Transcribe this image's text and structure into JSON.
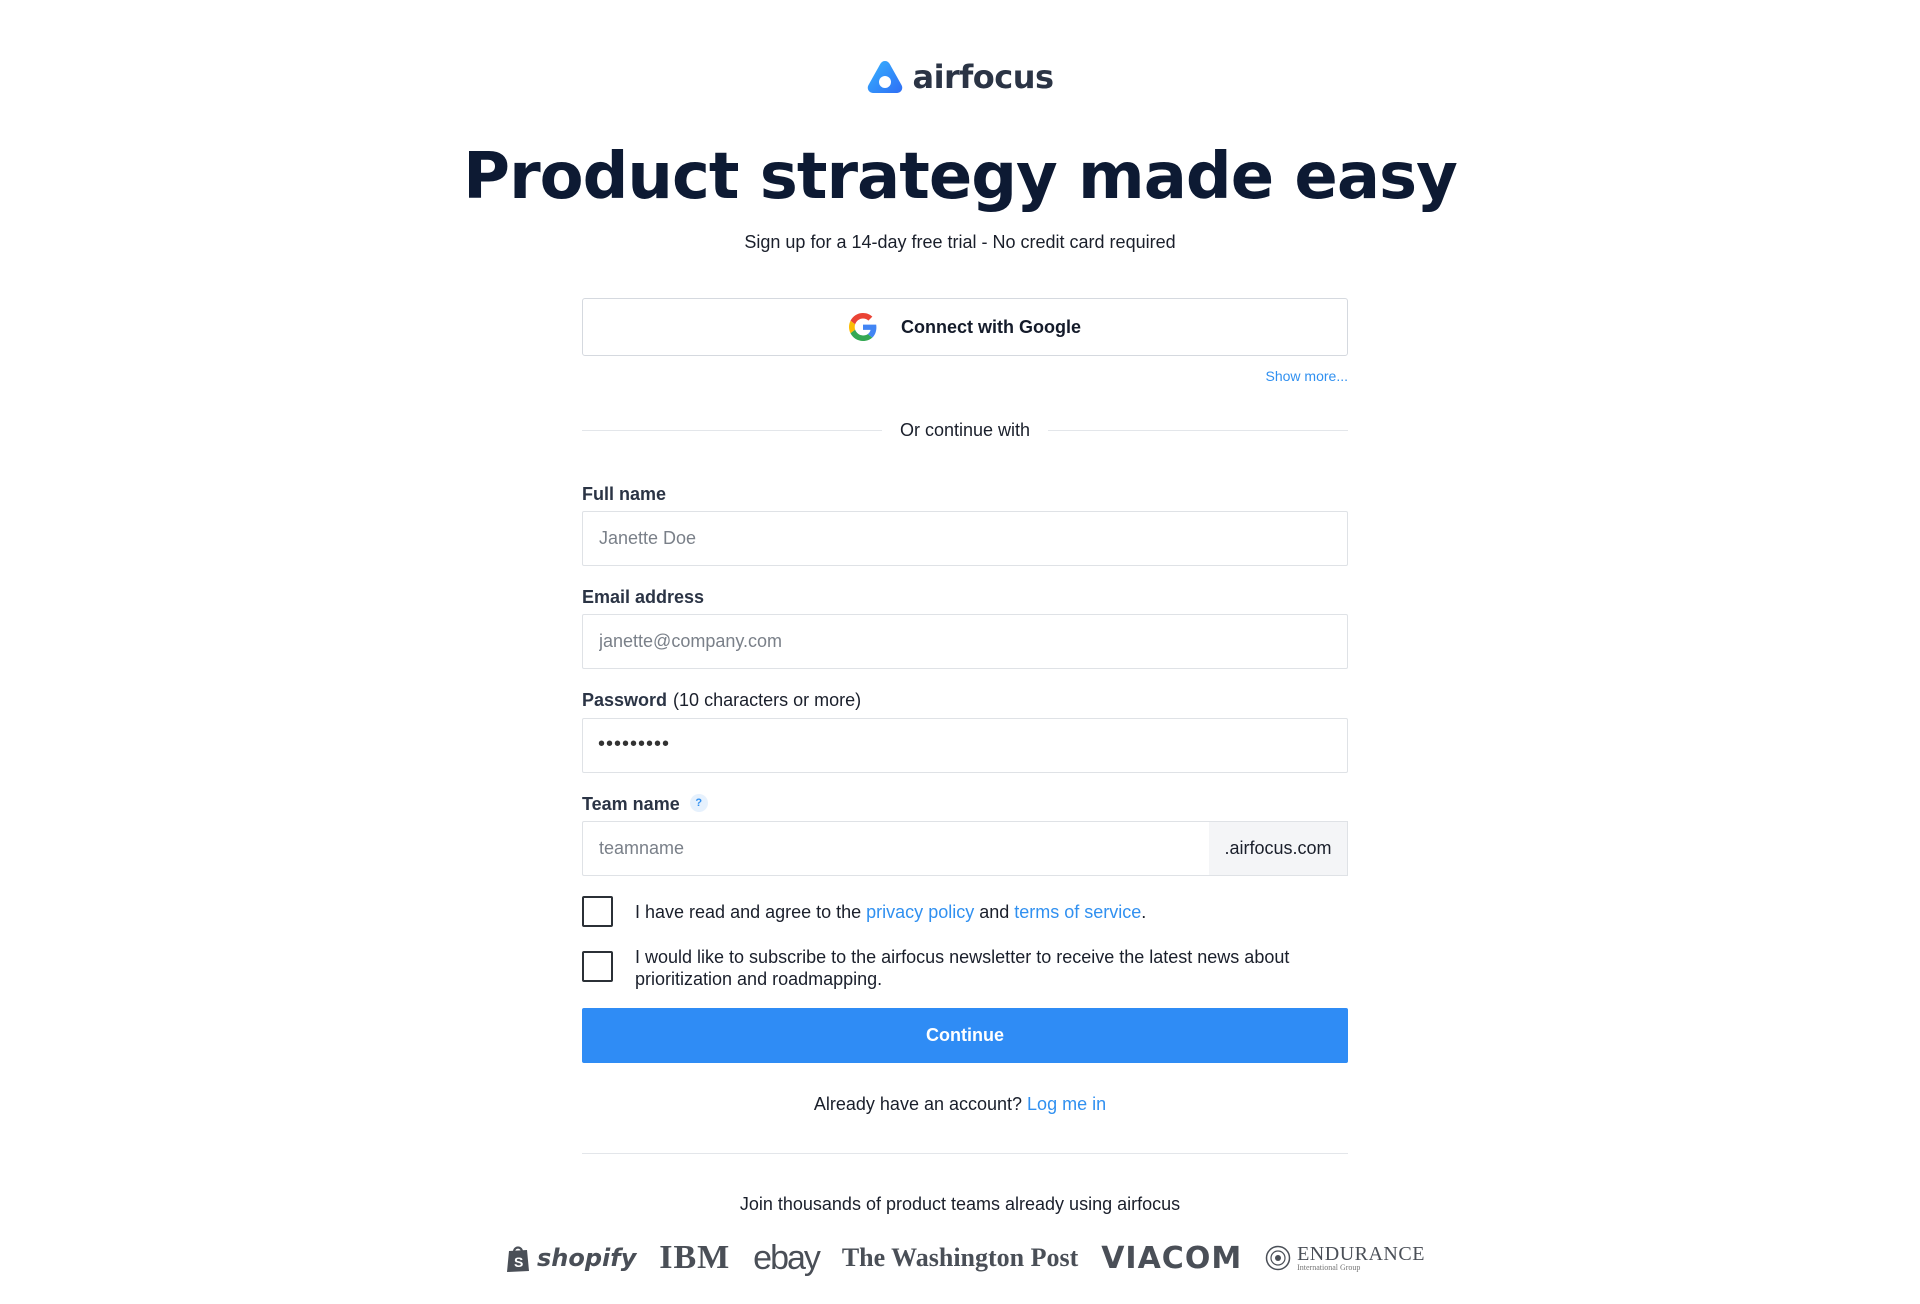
{
  "brand": {
    "name": "airfocus",
    "accent": "#2f8cf5",
    "heading_color": "#0d1a33"
  },
  "hero": {
    "title": "Product strategy made easy",
    "subtitle": "Sign up for a 14-day free trial - No credit card required"
  },
  "social_login": {
    "google_label": "Connect with Google",
    "google_icon": "google-icon",
    "show_more": "Show more..."
  },
  "divider_text": "Or continue with",
  "form": {
    "full_name": {
      "label": "Full name",
      "placeholder": "Janette Doe"
    },
    "email": {
      "label": "Email address",
      "placeholder": "janette@company.com"
    },
    "password": {
      "label": "Password",
      "hint": "(10 characters or more)",
      "masked_value": "•••••••••"
    },
    "team_name": {
      "label": "Team name",
      "help_icon": "?",
      "placeholder": "teamname",
      "suffix": ".airfocus.com"
    },
    "consent": {
      "prefix": "I have read and agree to the ",
      "privacy_link": "privacy policy",
      "middle": " and ",
      "terms_link": "terms of service",
      "suffix": ".",
      "checked": false
    },
    "newsletter": {
      "text": "I would like to subscribe to the airfocus newsletter to receive the latest news about prioritization and roadmapping.",
      "checked": false
    },
    "submit_label": "Continue"
  },
  "login": {
    "prompt": "Already have an account? ",
    "link": "Log me in"
  },
  "customers": {
    "heading": "Join thousands of product teams already using airfocus",
    "logos": [
      "shopify",
      "IBM",
      "ebay",
      "The Washington Post",
      "VIACOM",
      "ENDURANCE",
      "International Group"
    ]
  }
}
